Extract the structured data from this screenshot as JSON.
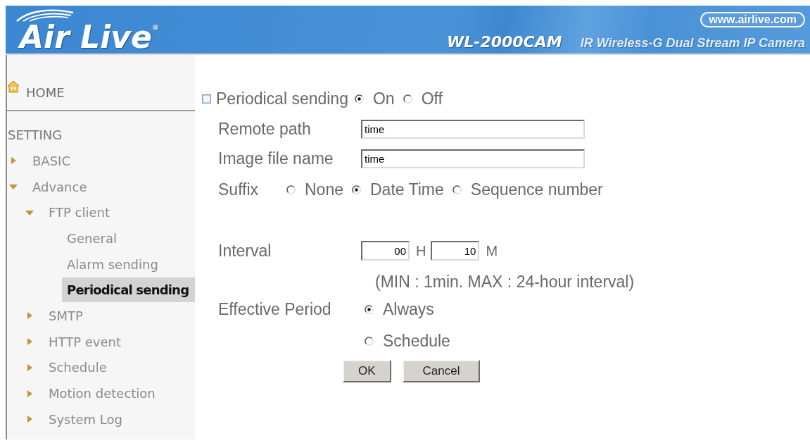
{
  "header": {
    "logo": "Air Live$^{®}$",
    "website": "www.airlive.com",
    "model": "WL-2000CAM",
    "product": "IR Wireless-G Dual Stream IP Camera"
  },
  "sidebar": {
    "home": "HOME",
    "section": "SETTING",
    "items": [
      {
        "label": "BASIC",
        "expanded": false,
        "selected": false
      },
      {
        "label": "Advance",
        "expanded": true,
        "selected": false,
        "children": [
          {
            "label": "FTP client",
            "expanded": true,
            "selected": false,
            "children": [
              {
                "label": "General",
                "selected": false
              },
              {
                "label": "Alarm sending",
                "selected": false
              },
              {
                "label": "Periodical sending",
                "selected": true
              }
            ]
          },
          {
            "label": "SMTP",
            "expanded": false,
            "selected": false
          },
          {
            "label": "HTTP event",
            "expanded": false,
            "selected": false
          },
          {
            "label": "Schedule",
            "expanded": false,
            "selected": false
          },
          {
            "label": "Motion detection",
            "expanded": false,
            "selected": false
          },
          {
            "label": "System Log",
            "expanded": false,
            "selected": false
          }
        ]
      }
    ]
  },
  "form": {
    "periodical_sending": {
      "label": "Periodical sending",
      "options": [
        {
          "label": "On",
          "selected": true
        },
        {
          "label": "Off",
          "selected": false
        }
      ]
    },
    "fields": [
      {
        "label": "Remote path",
        "value": "time"
      },
      {
        "label": "Image file name",
        "value": "time"
      }
    ],
    "suffix": {
      "label": "Suffix",
      "options": [
        {
          "label": "None",
          "selected": false
        },
        {
          "label": "Date Time",
          "selected": true
        },
        {
          "label": "Sequence number",
          "selected": false
        }
      ]
    },
    "interval": {
      "label": "Interval",
      "inputs": [
        {
          "value": "00",
          "unit": "H"
        },
        {
          "value": "10",
          "unit": "M"
        }
      ],
      "hint": "(MIN : 1min. MAX : 24-hour interval)"
    },
    "effective_period": {
      "label": "Effective Period",
      "options": [
        {
          "label": "Always",
          "selected": true
        },
        {
          "label": "Schedule",
          "selected": false
        }
      ]
    },
    "buttons": [
      "OK",
      "Cancel"
    ]
  }
}
